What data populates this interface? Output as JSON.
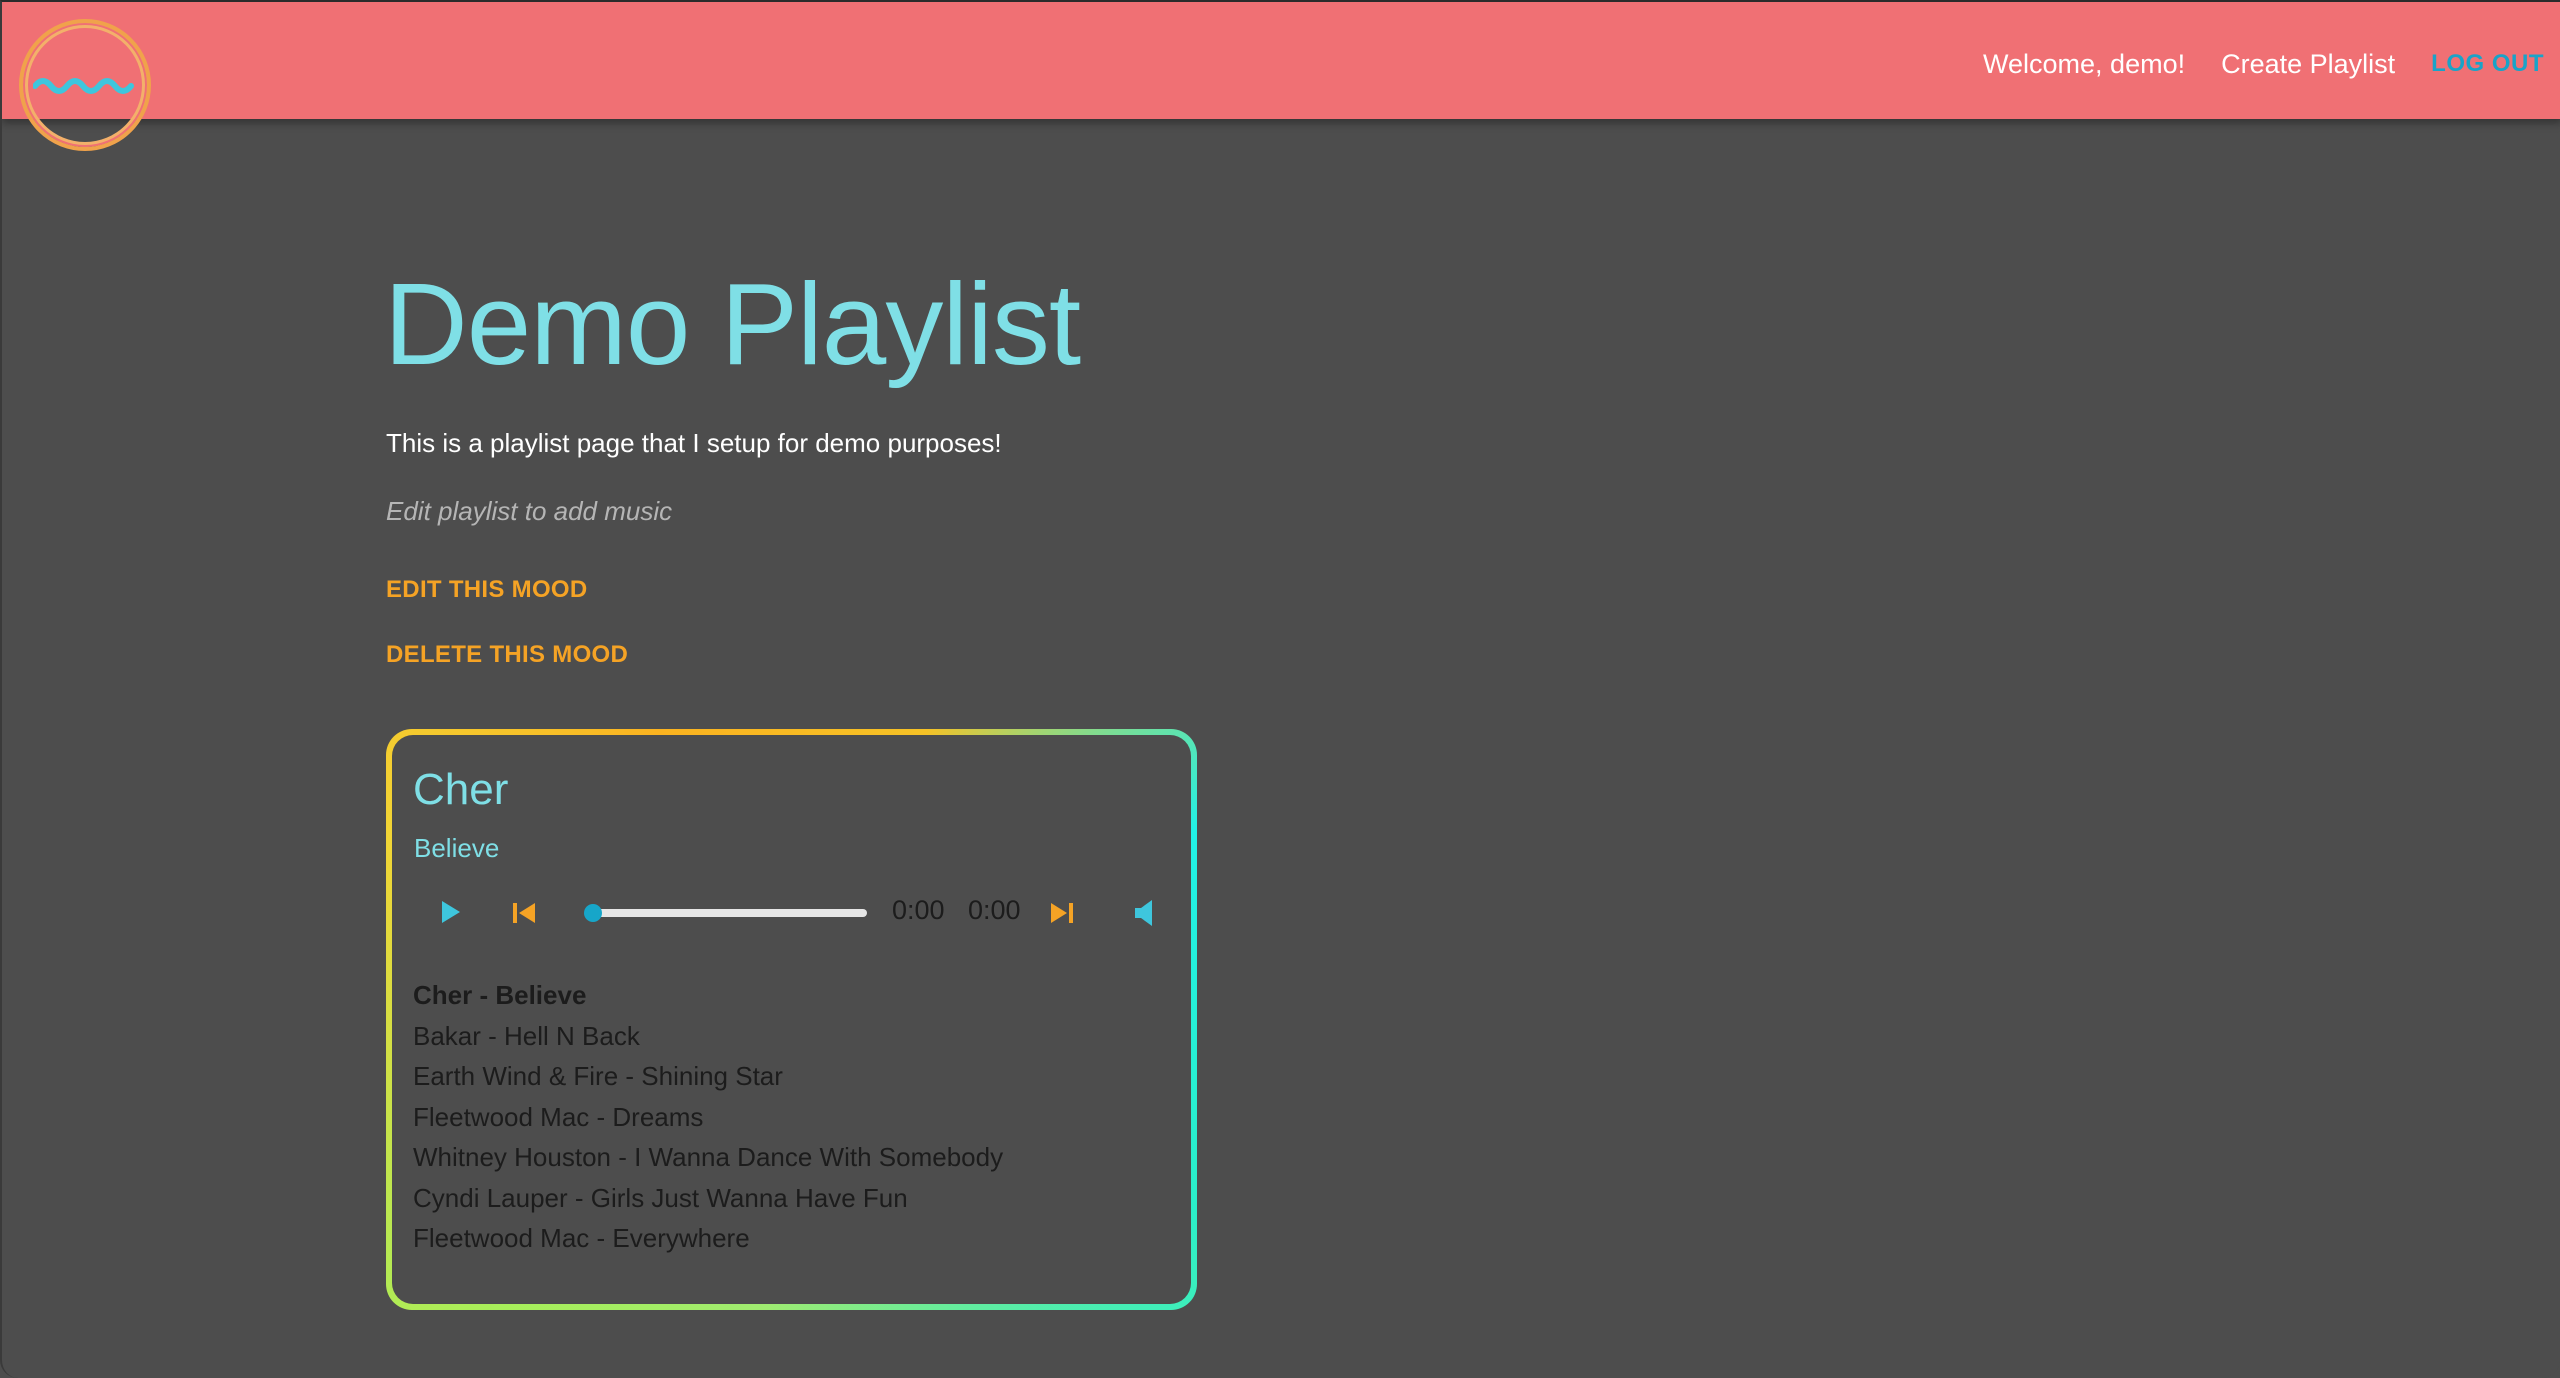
{
  "header": {
    "logo_icon": "wave-circle-logo",
    "welcome": "Welcome, demo!",
    "create_playlist": "Create Playlist",
    "logout": "LOG OUT",
    "colors": {
      "background": "#f07074",
      "logout": "#19a3c8",
      "logo_ring": "#f0a24b",
      "logo_wave": "#3ec6dd"
    }
  },
  "page": {
    "title": "Demo Playlist",
    "description": "This is a playlist page that I setup for demo purposes!",
    "hint": "Edit playlist to add music",
    "edit_link": "EDIT THIS MOOD",
    "delete_link": "DELETE THIS MOOD",
    "colors": {
      "background": "#4d4d4d",
      "title": "#7fdfe6",
      "accent": "#f5a325"
    }
  },
  "player": {
    "now_playing": {
      "artist": "Cher",
      "title": "Believe"
    },
    "current_time": "0:00",
    "duration": "0:00",
    "progress_fraction": 0.0,
    "icons": {
      "play": "play-icon",
      "previous": "skip-previous-icon",
      "next": "skip-next-icon",
      "volume": "volume-icon"
    },
    "colors": {
      "play": "#3ec6dd",
      "skip": "#f5a325",
      "progress": "#17a6c9"
    },
    "tracks": [
      {
        "label": "Cher - Believe",
        "active": true
      },
      {
        "label": "Bakar - Hell N Back",
        "active": false
      },
      {
        "label": "Earth Wind & Fire - Shining Star",
        "active": false
      },
      {
        "label": "Fleetwood Mac - Dreams",
        "active": false
      },
      {
        "label": "Whitney Houston - I Wanna Dance With Somebody",
        "active": false
      },
      {
        "label": "Cyndi Lauper - Girls Just Wanna Have Fun",
        "active": false
      },
      {
        "label": "Fleetwood Mac - Everywhere",
        "active": false
      }
    ]
  }
}
